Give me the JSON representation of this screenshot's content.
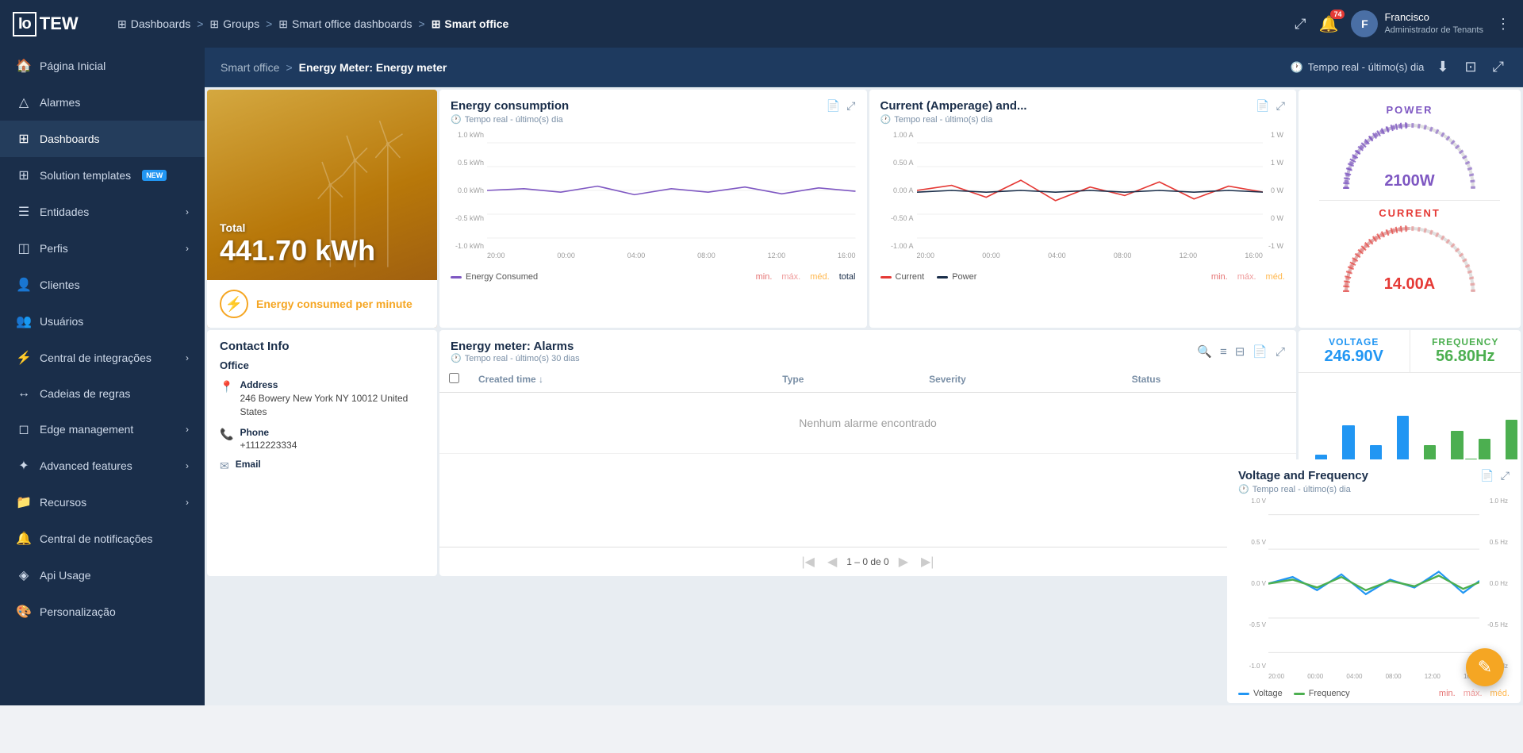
{
  "app": {
    "logo": "IoTEW",
    "logo_box": "Io"
  },
  "topnav": {
    "breadcrumb": [
      {
        "label": "Dashboards",
        "icon": "⊞"
      },
      {
        "sep": ">"
      },
      {
        "label": "Groups",
        "icon": "⊞"
      },
      {
        "sep": ">"
      },
      {
        "label": "Smart office dashboards",
        "icon": "⊞"
      },
      {
        "sep": ">"
      },
      {
        "label": "Smart office",
        "icon": "⊞",
        "active": true
      }
    ],
    "expand_icon": "⤢",
    "notification_count": "74",
    "user": {
      "name": "Francisco",
      "role": "Administrador de Tenants",
      "initials": "F"
    },
    "menu_icon": "⋮"
  },
  "sidebar": {
    "items": [
      {
        "label": "Página Inicial",
        "icon": "🏠",
        "chevron": false
      },
      {
        "label": "Alarmes",
        "icon": "△",
        "chevron": false
      },
      {
        "label": "Dashboards",
        "icon": "⊞",
        "chevron": false,
        "active": true
      },
      {
        "label": "Solution templates",
        "icon": "⊞",
        "chevron": false,
        "badge": "NEW"
      },
      {
        "label": "Entidades",
        "icon": "☰",
        "chevron": true
      },
      {
        "label": "Perfis",
        "icon": "◫",
        "chevron": true
      },
      {
        "label": "Clientes",
        "icon": "👤",
        "chevron": false
      },
      {
        "label": "Usuários",
        "icon": "👥",
        "chevron": false
      },
      {
        "label": "Central de integrações",
        "icon": "⚡",
        "chevron": true
      },
      {
        "label": "Cadeias de regras",
        "icon": "↔",
        "chevron": false
      },
      {
        "label": "Edge management",
        "icon": "◻",
        "chevron": true
      },
      {
        "label": "Advanced features",
        "icon": "✦",
        "chevron": true
      },
      {
        "label": "Recursos",
        "icon": "📁",
        "chevron": true
      },
      {
        "label": "Central de notificações",
        "icon": "🔔",
        "chevron": false
      },
      {
        "label": "Api Usage",
        "icon": "◈",
        "chevron": false
      },
      {
        "label": "Personalização",
        "icon": "🎨",
        "chevron": false
      }
    ]
  },
  "subheader": {
    "breadcrumb_start": "Smart office",
    "sep": ">",
    "breadcrumb_end": "Energy Meter: Energy meter",
    "time_label": "Tempo real - último(s) dia",
    "download_icon": "⬇",
    "image_icon": "⊡",
    "expand_icon": "⤢"
  },
  "energy_banner": {
    "total_label": "Total",
    "value": "441.70 kWh",
    "footer_label": "Energy consumed per minute"
  },
  "energy_chart": {
    "title": "Energy consumption",
    "subtitle": "Tempo real - último(s) dia",
    "y_labels": [
      "1.0 kWh",
      "0.5 kWh",
      "0.0 kWh",
      "-0.5 kWh",
      "-1.0 kWh"
    ],
    "x_labels": [
      "20:00",
      "00:00",
      "04:00",
      "08:00",
      "12:00",
      "16:00"
    ],
    "legend": [
      {
        "label": "Energy Consumed",
        "color": "#7e57c2"
      }
    ],
    "min_max": [
      {
        "label": "min.",
        "color": "#e57373"
      },
      {
        "label": "máx.",
        "color": "#ef9a9a"
      },
      {
        "label": "méd.",
        "color": "#ffb74d"
      },
      {
        "label": "total",
        "color": "#1a2e4a"
      }
    ]
  },
  "amperage_chart": {
    "title": "Current (Amperage) and...",
    "subtitle": "Tempo real - último(s) dia",
    "y_left_labels": [
      "1.00 A",
      "0.50 A",
      "0.00 A",
      "-0.50 A",
      "-1.00 A"
    ],
    "y_right_labels": [
      "1 W",
      "1 W",
      "0 W",
      "0 W",
      "-1 W"
    ],
    "x_labels": [
      "20:00",
      "00:00",
      "04:00",
      "08:00",
      "12:00",
      "16:00"
    ],
    "legend": [
      {
        "label": "Current",
        "color": "#e53935"
      },
      {
        "label": "Power",
        "color": "#1a2e4a"
      }
    ],
    "min_max": [
      {
        "label": "min.",
        "color": "#e57373"
      },
      {
        "label": "máx.",
        "color": "#ef9a9a"
      },
      {
        "label": "méd.",
        "color": "#ffb74d"
      }
    ]
  },
  "power_gauge": {
    "title": "POWER",
    "value": "2100W",
    "color": "#7e57c2",
    "current_title": "CURRENT",
    "current_value": "14.00A",
    "current_color": "#e53935"
  },
  "contact_info": {
    "header": "Contact Info",
    "section": "Office",
    "address_label": "Address",
    "address_value": "246 Bowery New York NY 10012 United States",
    "phone_label": "Phone",
    "phone_value": "+1112223334",
    "email_label": "Email"
  },
  "alarms": {
    "title": "Energy meter: Alarms",
    "subtitle": "Tempo real - último(s) 30 dias",
    "columns": [
      "Created time",
      "Type",
      "Severity",
      "Status"
    ],
    "no_data": "Nenhum alarme encontrado",
    "pagination": "1 – 0 de 0"
  },
  "voltage_chart": {
    "title": "Voltage and Frequency",
    "subtitle": "Tempo real - último(s) dia",
    "y_left_labels": [
      "1.0 V",
      "0.5 V",
      "0.0 V",
      "-0.5 V",
      "-1.0 V"
    ],
    "y_right_labels": [
      "1.0 Hz",
      "0.5 Hz",
      "0.0 Hz",
      "-0.5 Hz",
      "-1.0 Hz"
    ],
    "x_labels": [
      "20:00",
      "00:00",
      "04:00",
      "08:00",
      "12:00",
      "16:00"
    ],
    "legend": [
      {
        "label": "Voltage",
        "color": "#2196f3"
      },
      {
        "label": "Frequency",
        "color": "#4caf50"
      }
    ],
    "min_max": [
      {
        "label": "min.",
        "color": "#e57373"
      },
      {
        "label": "máx.",
        "color": "#ef9a9a"
      },
      {
        "label": "méd.",
        "color": "#ffb74d"
      }
    ]
  },
  "volt_freq": {
    "voltage_title": "VOLTAGE",
    "voltage_value": "246.90V",
    "frequency_title": "FREQUENCY",
    "frequency_value": "56.80Hz"
  }
}
